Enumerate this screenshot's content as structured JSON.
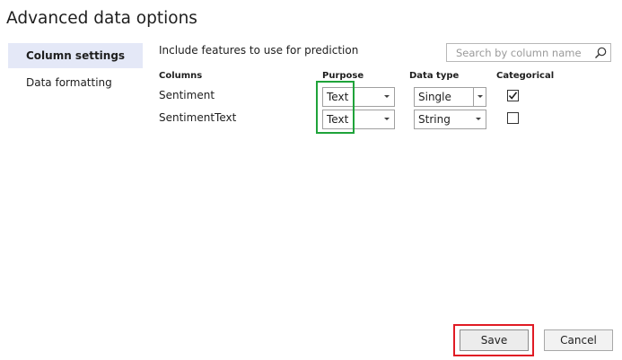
{
  "window": {
    "title": "Advanced data options"
  },
  "sidebar": {
    "items": [
      {
        "label": "Column settings",
        "selected": true
      },
      {
        "label": "Data formatting",
        "selected": false
      }
    ]
  },
  "main": {
    "include_label": "Include features to use for prediction",
    "search": {
      "placeholder": "Search by column name",
      "value": ""
    },
    "table": {
      "headers": [
        "Columns",
        "Purpose",
        "Data type",
        "Categorical"
      ],
      "rows": [
        {
          "column": "Sentiment",
          "purpose": "Text",
          "data_type": "Single",
          "categorical": true
        },
        {
          "column": "SentimentText",
          "purpose": "Text",
          "data_type": "String",
          "categorical": false
        }
      ]
    }
  },
  "footer": {
    "save_label": "Save",
    "cancel_label": "Cancel"
  },
  "colors": {
    "selected_nav_bg": "#e4e8f7",
    "purpose_highlight": "#1fa33a",
    "save_highlight": "#e01b24"
  },
  "icons": {
    "search": "search-icon",
    "dropdown": "chevron-down-icon",
    "check": "checkmark-icon"
  }
}
